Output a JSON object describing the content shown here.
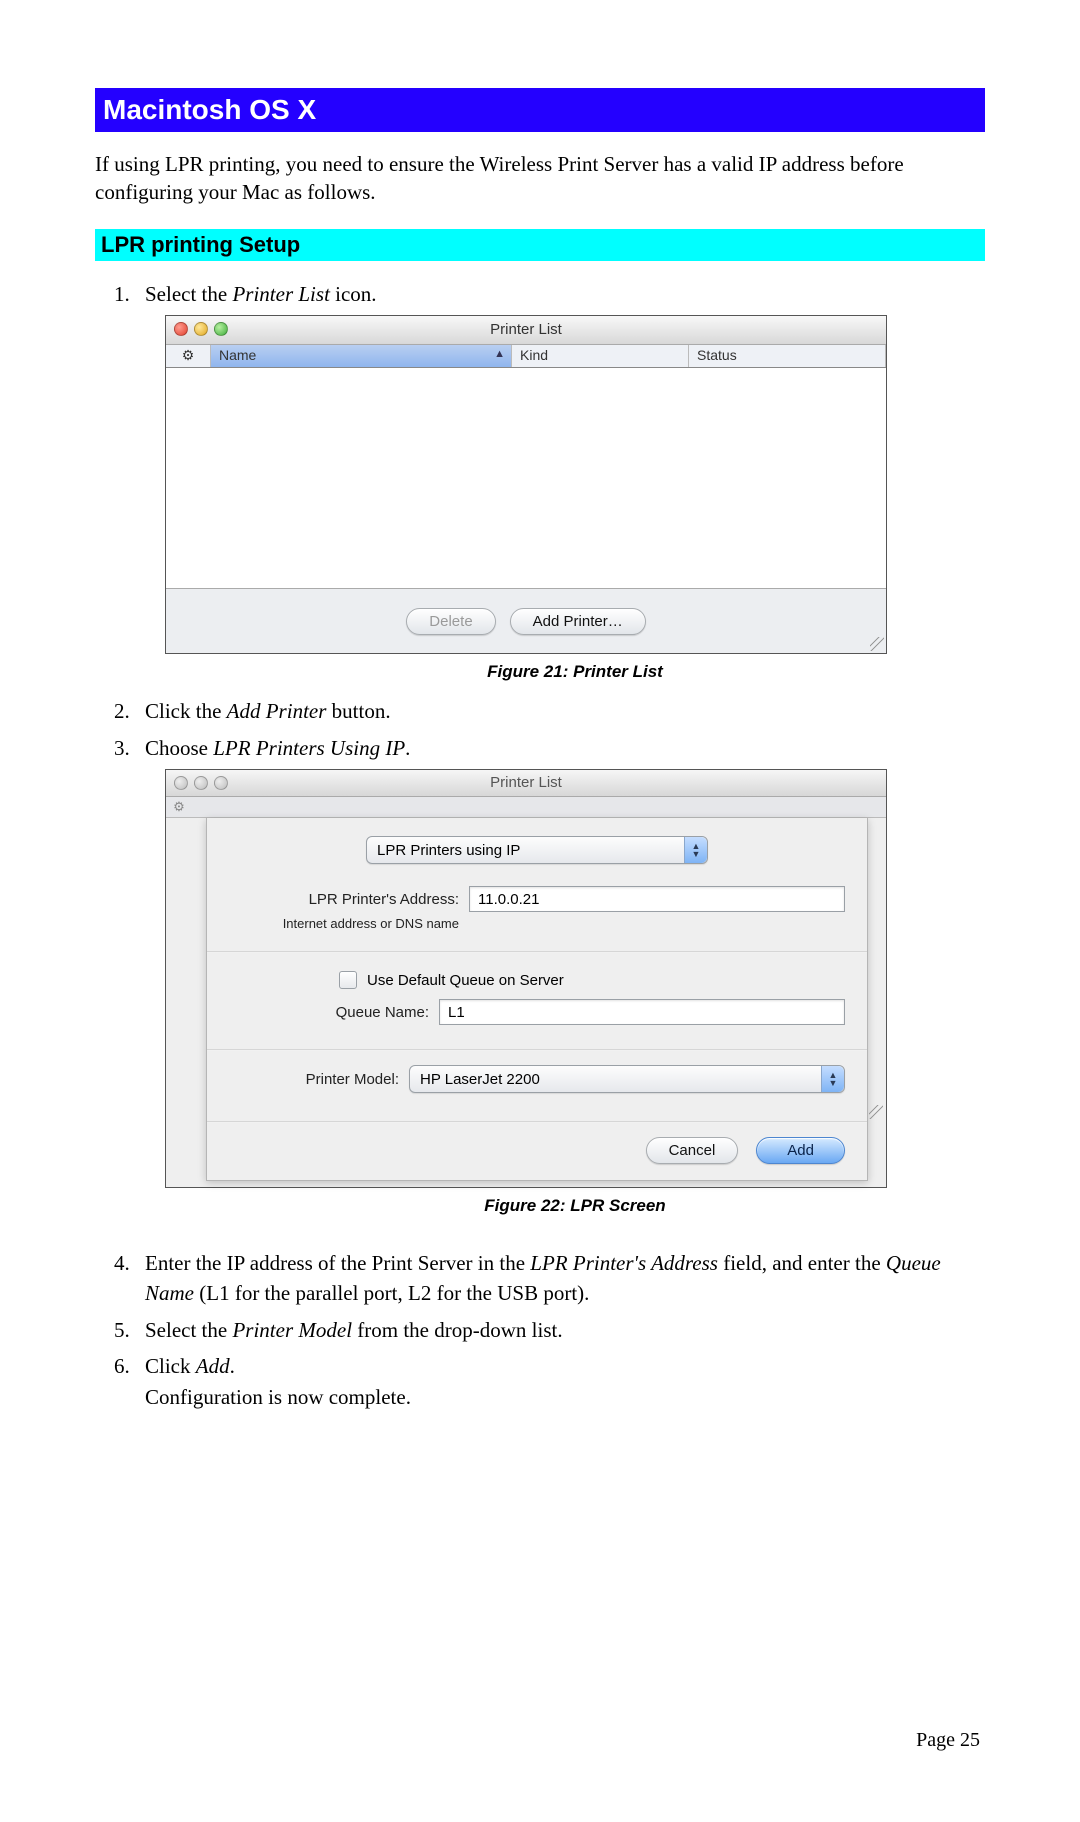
{
  "headings": {
    "h1": "Macintosh OS X",
    "h2": "LPR printing Setup"
  },
  "intro": "If using LPR printing, you need to ensure the Wireless Print Server has a valid IP address before configuring your Mac as follows.",
  "steps": {
    "s1_pre": "Select the ",
    "s1_em": "Printer List",
    "s1_post": " icon.",
    "s2_pre": "Click the ",
    "s2_em": "Add Printer",
    "s2_post": " button.",
    "s3_pre": "Choose ",
    "s3_em": "LPR Printers Using IP",
    "s3_post": ".",
    "s4_pre": "Enter the IP address of the Print Server in the ",
    "s4_em1": "LPR Printer's Address",
    "s4_mid": " field, and enter the ",
    "s4_em2": "Queue Name",
    "s4_post": " (L1 for the parallel port, L2 for the USB port).",
    "s5_pre": "Select the ",
    "s5_em": "Printer Model",
    "s5_post": " from the drop-down list.",
    "s6_pre": "Click ",
    "s6_em": "Add",
    "s6_post": ".",
    "s6_line2": "Configuration is now complete."
  },
  "fig21": {
    "caption": "Figure 21: Printer List",
    "window_title": "Printer List",
    "columns": {
      "name": "Name",
      "kind": "Kind",
      "status": "Status"
    },
    "buttons": {
      "delete": "Delete",
      "add": "Add Printer…"
    }
  },
  "fig22": {
    "caption": "Figure 22: LPR Screen",
    "window_title": "Printer List",
    "dropdown_value": "LPR Printers using IP",
    "labels": {
      "address": "LPR Printer's Address:",
      "address_hint": "Internet address or DNS name",
      "use_default": "Use Default Queue on Server",
      "queue": "Queue Name:",
      "model": "Printer Model:"
    },
    "values": {
      "address": "11.0.0.21",
      "queue": "L1",
      "model": "HP LaserJet 2200"
    },
    "buttons": {
      "cancel": "Cancel",
      "add": "Add"
    }
  },
  "page_number": "Page 25"
}
